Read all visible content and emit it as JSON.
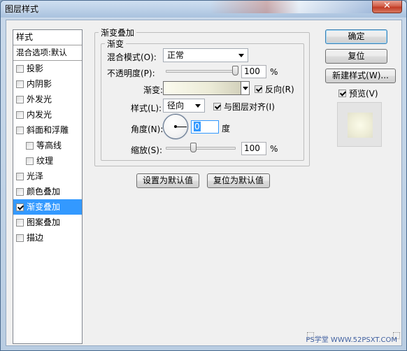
{
  "window": {
    "title": "图层样式",
    "close_glyph": "✕"
  },
  "style_list": {
    "header": "样式",
    "blend_options": "混合选项:默认",
    "items": [
      {
        "label": "投影",
        "checked": false,
        "indent": false,
        "selected": false
      },
      {
        "label": "内阴影",
        "checked": false,
        "indent": false,
        "selected": false
      },
      {
        "label": "外发光",
        "checked": false,
        "indent": false,
        "selected": false
      },
      {
        "label": "内发光",
        "checked": false,
        "indent": false,
        "selected": false
      },
      {
        "label": "斜面和浮雕",
        "checked": false,
        "indent": false,
        "selected": false
      },
      {
        "label": "等高线",
        "checked": false,
        "indent": true,
        "selected": false
      },
      {
        "label": "纹理",
        "checked": false,
        "indent": true,
        "selected": false
      },
      {
        "label": "光泽",
        "checked": false,
        "indent": false,
        "selected": false
      },
      {
        "label": "颜色叠加",
        "checked": false,
        "indent": false,
        "selected": false
      },
      {
        "label": "渐变叠加",
        "checked": true,
        "indent": false,
        "selected": true
      },
      {
        "label": "图案叠加",
        "checked": false,
        "indent": false,
        "selected": false
      },
      {
        "label": "描边",
        "checked": false,
        "indent": false,
        "selected": false
      }
    ]
  },
  "panel": {
    "outer_title": "渐变叠加",
    "inner_title": "渐变",
    "blend_mode": {
      "label": "混合模式(O):",
      "value": "正常"
    },
    "opacity": {
      "label": "不透明度(P):",
      "value": "100",
      "unit": "%",
      "level": 1.0
    },
    "gradient": {
      "label": "渐变:",
      "reverse_label": "反向(R)",
      "reverse_checked": true,
      "colors": [
        "#fbfbef",
        "#ecebd7",
        "#d3d1bc"
      ]
    },
    "style": {
      "label": "样式(L):",
      "value": "径向",
      "align_label": "与图层对齐(I)",
      "align_checked": true
    },
    "angle": {
      "label": "角度(N):",
      "value": "0",
      "unit": "度"
    },
    "scale": {
      "label": "缩放(S):",
      "value": "100",
      "unit": "%",
      "level": 0.4
    },
    "set_default": "设置为默认值",
    "reset_default": "复位为默认值"
  },
  "buttons": {
    "ok": "确定",
    "reset": "复位",
    "new_style": "新建样式(W)...",
    "preview_label": "预览(V)",
    "preview_checked": true
  },
  "watermark": "PS学堂 WWW.52PSXT.COM"
}
